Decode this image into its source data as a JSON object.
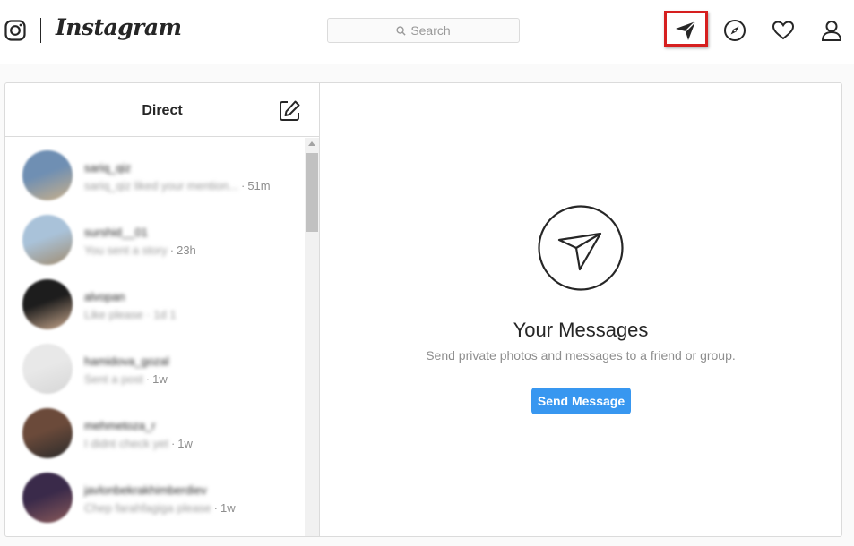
{
  "header": {
    "wordmark": "Instagram",
    "search": {
      "placeholder": "Search"
    },
    "icons": [
      "instagram-glyph-icon",
      "direct-send-icon",
      "explore-compass-icon",
      "activity-heart-icon",
      "profile-person-icon"
    ],
    "highlight_color": "#d61f1f"
  },
  "direct": {
    "title": "Direct",
    "compose_icon": "compose-icon",
    "threads": [
      {
        "username": "sariq_qiz",
        "preview": "sariq_qiz liked your mention...",
        "time": "51m",
        "avatar_colors": [
          "#6f8fb3",
          "#c9b08a"
        ]
      },
      {
        "username": "surshid__01",
        "preview": "You sent a story",
        "time": "23h",
        "avatar_colors": [
          "#a9c2d9",
          "#a08c70"
        ]
      },
      {
        "username": "alvopan",
        "preview": "Like please · 1d 1 ",
        "time": "",
        "avatar_colors": [
          "#1d1d1d",
          "#c9a88d"
        ]
      },
      {
        "username": "hamidova_gozal",
        "preview": "Sent a post",
        "time": "1w",
        "avatar_colors": [
          "#e8e8e8",
          "#d6d6d6"
        ]
      },
      {
        "username": "mehmetoza_r",
        "preview": "I didnt check yet",
        "time": "1w",
        "avatar_colors": [
          "#6b4a3a",
          "#2b2b2b"
        ]
      },
      {
        "username": "javlonbekrakhimberdiev",
        "preview": "Chep farahfagiga please",
        "time": "1w",
        "avatar_colors": [
          "#3a2a4a",
          "#8a5a5a"
        ]
      }
    ]
  },
  "empty_state": {
    "icon": "direct-send-icon",
    "title": "Your Messages",
    "subtitle": "Send private photos and messages to a friend or group.",
    "button_label": "Send Message",
    "button_color": "#3897f0"
  }
}
